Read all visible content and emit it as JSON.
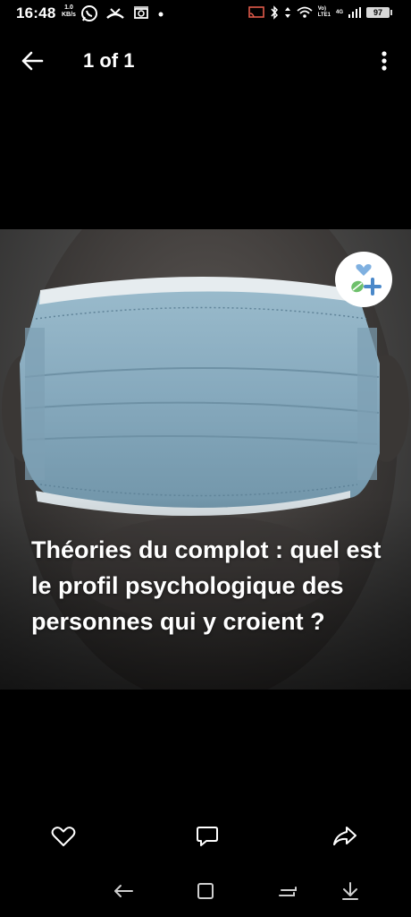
{
  "status_bar": {
    "time": "16:48",
    "speed_value": "1.0",
    "speed_unit": "KB/s",
    "net_label_top": "Vo)",
    "net_label_bottom": "LTE1",
    "net_type": "4G",
    "battery_level": "97"
  },
  "app_bar": {
    "page_counter": "1 of 1"
  },
  "post": {
    "headline": "Théories du complot : quel est le profil psychologique des personnes qui y croient ?"
  },
  "icons": {
    "back": "arrow-left-icon",
    "more": "more-vertical-icon",
    "like": "heart-icon",
    "comment": "comment-icon",
    "share": "share-icon",
    "badge": "heart-plus-badge-icon"
  },
  "colors": {
    "background": "#000000",
    "mask_blue": "#8fb3c6",
    "badge_blue": "#4a88c9",
    "badge_green": "#6ec06b"
  }
}
